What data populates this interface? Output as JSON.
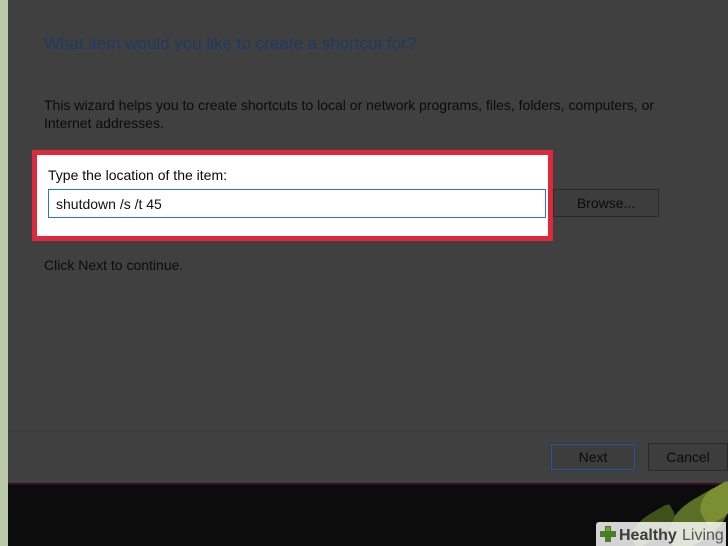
{
  "wizard": {
    "heading": "What item would you like to create a shortcut for?",
    "description": "This wizard helps you to create shortcuts to local or network programs, files, folders, computers, or Internet addresses.",
    "location_label": "Type the location of the item:",
    "location_value": "shutdown /s /t 45",
    "browse_label": "Browse...",
    "continue_text": "Click Next to continue.",
    "next_label": "Next",
    "cancel_label": "Cancel"
  },
  "highlight_color": "#dc2a3c",
  "watermark": {
    "brand_bold": "Healthy",
    "brand_light": "Living",
    "icon": "plus-cross-icon"
  }
}
